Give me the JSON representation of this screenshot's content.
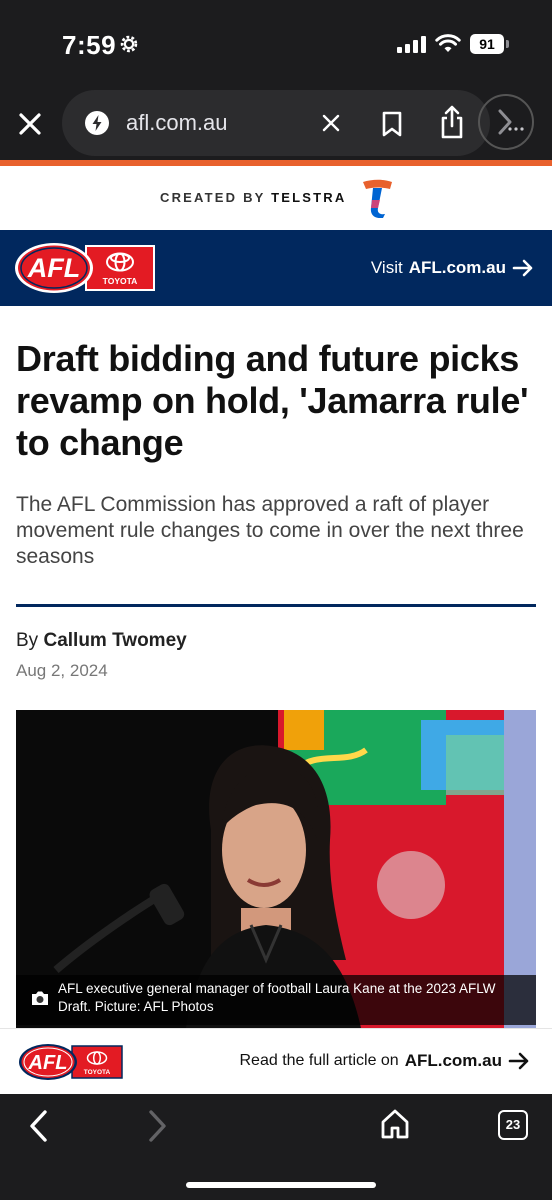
{
  "status": {
    "time": "7:59",
    "battery": "91"
  },
  "browser": {
    "url": "afl.com.au"
  },
  "banner": {
    "prefix": "CREATED BY",
    "brand": "TELSTRA"
  },
  "header": {
    "visit_prefix": "Visit",
    "visit_site": "AFL.com.au",
    "logo_text": "AFL",
    "sponsor": "TOYOTA"
  },
  "article": {
    "headline": "Draft bidding and future picks revamp on hold, 'Jamarra rule' to change",
    "subhead": "The AFL Commission has approved a raft of player movement rule changes to come in over the next three seasons",
    "by_prefix": "By",
    "author": "Callum Twomey",
    "date": "Aug 2, 2024",
    "caption": "AFL executive general manager of football Laura Kane at the 2023 AFLW Draft. Picture: AFL Photos"
  },
  "promo": {
    "text": "Read the full article on",
    "site": "AFL.com.au",
    "logo_text": "AFL",
    "sponsor": "TOYOTA"
  },
  "toolbar": {
    "tab_count": "23"
  },
  "colors": {
    "navy": "#01285e",
    "accent": "#e8612d",
    "afl_red": "#e31b23",
    "telstra_blue": "#0064d2"
  },
  "icons": [
    "gear-icon",
    "signal-icon",
    "wifi-icon",
    "close-icon",
    "lightning-icon",
    "bookmark-icon",
    "share-icon",
    "more-icon",
    "arrow-right-icon",
    "camera-icon",
    "back-icon",
    "forward-icon",
    "home-icon"
  ]
}
